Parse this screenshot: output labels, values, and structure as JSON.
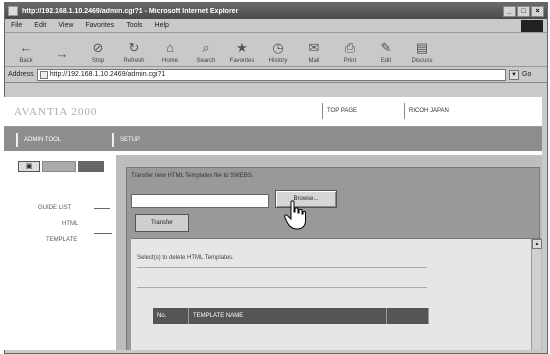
{
  "window": {
    "title": "http://192.168.1.10.2469/admin.cgi?1 - Microsoft Internet Explorer",
    "controls": [
      "_",
      "□",
      "×"
    ]
  },
  "menu": [
    "File",
    "Edit",
    "View",
    "Favorites",
    "Tools",
    "Help"
  ],
  "toolbar": [
    {
      "label": "Back",
      "icon": "back-arrow-icon",
      "glyph": "←"
    },
    {
      "label": "",
      "icon": "forward-arrow-icon",
      "glyph": "→"
    },
    {
      "label": "Stop",
      "icon": "stop-icon",
      "glyph": "⊘"
    },
    {
      "label": "Refresh",
      "icon": "refresh-icon",
      "glyph": "↻"
    },
    {
      "label": "Home",
      "icon": "home-icon",
      "glyph": "⌂"
    },
    {
      "label": "Search",
      "icon": "search-icon",
      "glyph": "⌕"
    },
    {
      "label": "Favorites",
      "icon": "favorites-icon",
      "glyph": "★"
    },
    {
      "label": "History",
      "icon": "history-icon",
      "glyph": "◷"
    },
    {
      "label": "Mail",
      "icon": "mail-icon",
      "glyph": "✉"
    },
    {
      "label": "Print",
      "icon": "print-icon",
      "glyph": "⎙"
    },
    {
      "label": "Edit",
      "icon": "edit-icon",
      "glyph": "✎"
    },
    {
      "label": "Discuss",
      "icon": "discuss-icon",
      "glyph": "▤"
    }
  ],
  "address": {
    "label": "Address",
    "url": "http://192.168.1.10.2469/admin.cgi?1",
    "go": "Go"
  },
  "page": {
    "brand": "AVANTIA 2000",
    "links": [
      "TOP PAGE",
      "RICOH JAPAN"
    ],
    "tabs": [
      "ADMIN TOOL",
      "SETUP"
    ]
  },
  "sidebar": {
    "links": [
      "GUIDE LIST",
      "HTML",
      "TEMPLATE"
    ]
  },
  "form": {
    "prompt": "Transfer new HTML Templates file to SWEBS.",
    "file_value": "",
    "browse_label": "Browse...",
    "transfer_label": "Transfer",
    "delete_msg": "Select(s) to delete HTML Templates.",
    "table_headers": [
      "No.",
      "TEMPLATE NAME",
      ""
    ]
  }
}
